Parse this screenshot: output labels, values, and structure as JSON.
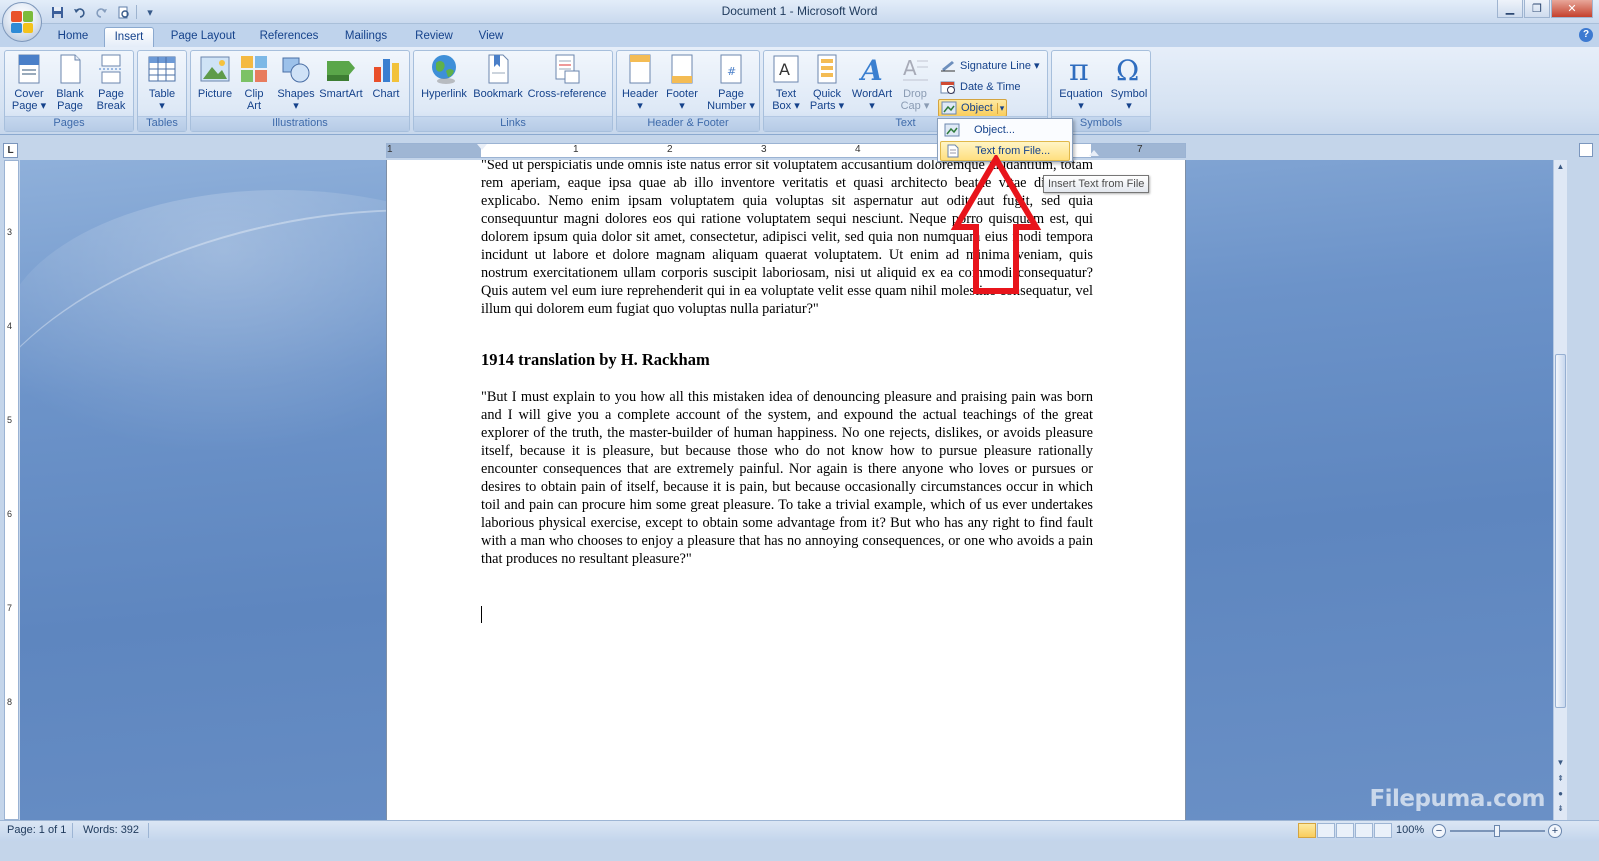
{
  "window": {
    "title": "Document 1 - Microsoft Word",
    "controls": [
      "minimize",
      "restore",
      "close"
    ]
  },
  "quick_access": [
    "save-icon",
    "undo-icon",
    "redo-icon",
    "print-preview-icon",
    "customize-dropdown-icon"
  ],
  "tabs": [
    {
      "label": "Home",
      "active": false
    },
    {
      "label": "Insert",
      "active": true
    },
    {
      "label": "Page Layout",
      "active": false
    },
    {
      "label": "References",
      "active": false
    },
    {
      "label": "Mailings",
      "active": false
    },
    {
      "label": "Review",
      "active": false
    },
    {
      "label": "View",
      "active": false
    }
  ],
  "ribbon": {
    "groups": {
      "pages": {
        "label": "Pages",
        "buttons": {
          "cover": "Cover\nPage ▾",
          "blank": "Blank\nPage",
          "break": "Page\nBreak"
        }
      },
      "tables": {
        "label": "Tables",
        "buttons": {
          "table": "Table\n▾"
        }
      },
      "illustrations": {
        "label": "Illustrations",
        "buttons": {
          "picture": "Picture",
          "clipart": "Clip\nArt",
          "shapes": "Shapes\n▾",
          "smartart": "SmartArt",
          "chart": "Chart"
        }
      },
      "links": {
        "label": "Links",
        "buttons": {
          "hyperlink": "Hyperlink",
          "bookmark": "Bookmark",
          "crossref": "Cross-reference"
        }
      },
      "header_footer": {
        "label": "Header & Footer",
        "buttons": {
          "header": "Header\n▾",
          "footer": "Footer\n▾",
          "pagenumber": "Page\nNumber ▾"
        }
      },
      "text": {
        "label": "Text",
        "buttons": {
          "textbox": "Text\nBox ▾",
          "quickparts": "Quick\nParts ▾",
          "wordart": "WordArt\n▾",
          "dropcap": "Drop\nCap ▾",
          "signature": "Signature Line ▾",
          "datetime": "Date & Time",
          "object": "Object"
        }
      },
      "symbols": {
        "label": "Symbols",
        "buttons": {
          "equation": "Equation\n▾",
          "symbol": "Symbol\n▾"
        }
      }
    }
  },
  "dropdown": {
    "items": [
      "Object...",
      "Text from File..."
    ],
    "hovered_index": 1,
    "tooltip": "Insert Text from File"
  },
  "ruler": {
    "corner": "L",
    "numbers": [
      "1",
      "1",
      "2",
      "3",
      "4",
      "5",
      "6",
      "7"
    ]
  },
  "vruler_numbers": [
    "3",
    "4",
    "5",
    "6",
    "7",
    "8"
  ],
  "document": {
    "paragraph1": "\"Sed ut perspiciatis unde omnis iste natus error sit voluptatem accusantium doloremque laudantium, totam rem aperiam, eaque ipsa quae ab illo inventore veritatis et quasi architecto beatae vitae dicta sunt explicabo. Nemo enim ipsam voluptatem quia voluptas sit aspernatur aut odit aut fugit, sed quia consequuntur magni dolores eos qui ratione voluptatem sequi nesciunt. Neque porro quisquam est, qui dolorem ipsum quia dolor sit amet, consectetur, adipisci velit, sed quia non numquam eius modi tempora incidunt ut labore et dolore magnam aliquam quaerat voluptatem. Ut enim ad minima veniam, quis nostrum exercitationem ullam corporis suscipit laboriosam, nisi ut aliquid ex ea commodi consequatur? Quis autem vel eum iure reprehenderit qui in ea voluptate velit esse quam nihil molestiae consequatur, vel illum qui dolorem eum fugiat quo voluptas nulla pariatur?\"",
    "heading": "1914 translation by H. Rackham",
    "paragraph2": "\"But I must explain to you how all this mistaken idea of denouncing pleasure and praising pain was born and I will give you a complete account of the system, and expound the actual teachings of the great explorer of the truth, the master-builder of human happiness. No one rejects, dislikes, or avoids pleasure itself, because it is pleasure, but because those who do not know how to pursue pleasure rationally encounter consequences that are extremely painful. Nor again is there anyone who loves or pursues or desires to obtain pain of itself, because it is pain, but because occasionally circumstances occur in which toil and pain can procure him some great pleasure. To take a trivial example, which of us ever undertakes laborious physical exercise, except to obtain some advantage from it? But who has any right to find fault with a man who chooses to enjoy a pleasure that has no annoying consequences, or one who avoids a pain that produces no resultant pleasure?\""
  },
  "statusbar": {
    "page": "Page: 1 of 1",
    "words": "Words: 392",
    "zoom": "100%",
    "zoom_minus": "−",
    "zoom_plus": "+"
  },
  "watermark": "Filepuma.com",
  "colors": {
    "annotation_arrow": "#e8141b",
    "hover_bg": "#ffdf7f"
  }
}
